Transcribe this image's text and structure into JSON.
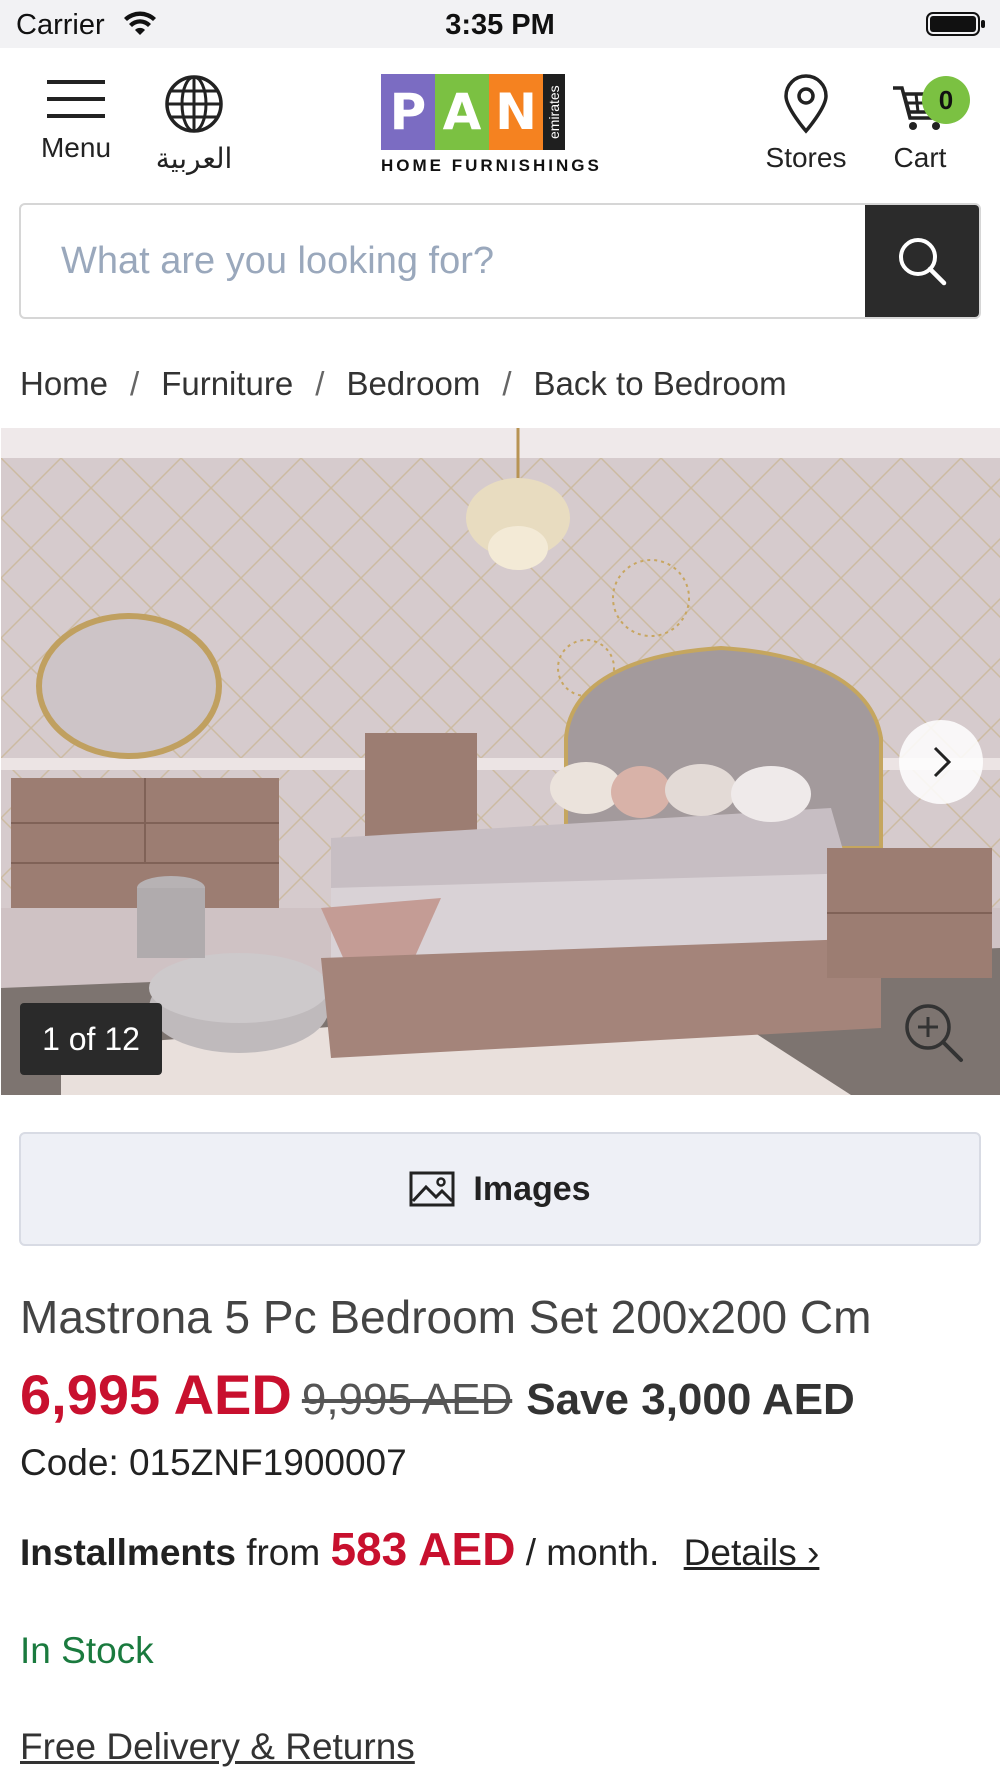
{
  "status_bar": {
    "carrier": "Carrier",
    "time": "3:35 PM"
  },
  "header": {
    "menu_label": "Menu",
    "language_label": "العربية",
    "stores_label": "Stores",
    "cart_label": "Cart",
    "cart_count": "0",
    "logo": {
      "letters": [
        "P",
        "A",
        "N"
      ],
      "side_text": "emirates",
      "tagline": "HOME FURNISHINGS",
      "colors": [
        "#7b6cc2",
        "#7bc142",
        "#f58220"
      ]
    }
  },
  "search": {
    "placeholder": "What are you looking for?"
  },
  "breadcrumb": {
    "items": [
      "Home",
      "Furniture",
      "Bedroom",
      "Back to Bedroom"
    ],
    "separator": "/"
  },
  "gallery": {
    "counter": "1 of 12",
    "icons": [
      "chevron-right-icon",
      "zoom-in-icon"
    ]
  },
  "images_button": {
    "label": "Images"
  },
  "product": {
    "title": "Mastrona 5 Pc Bedroom Set 200x200 Cm",
    "price": "6,995 AED",
    "old_price": "9,995 AED",
    "savings": "Save 3,000 AED",
    "code": "Code: 015ZNF1900007",
    "installments": {
      "label": "Installments",
      "from_text": "from",
      "amount": "583 AED",
      "per_text": "/ month.",
      "details_link": "Details ›"
    },
    "stock_status": "In Stock",
    "delivery_link": "Free Delivery & Returns"
  },
  "colors": {
    "price_red": "#c8102e",
    "stock_green": "#1a7a3e",
    "cart_badge": "#7bc142",
    "search_button": "#2b2b2b"
  }
}
